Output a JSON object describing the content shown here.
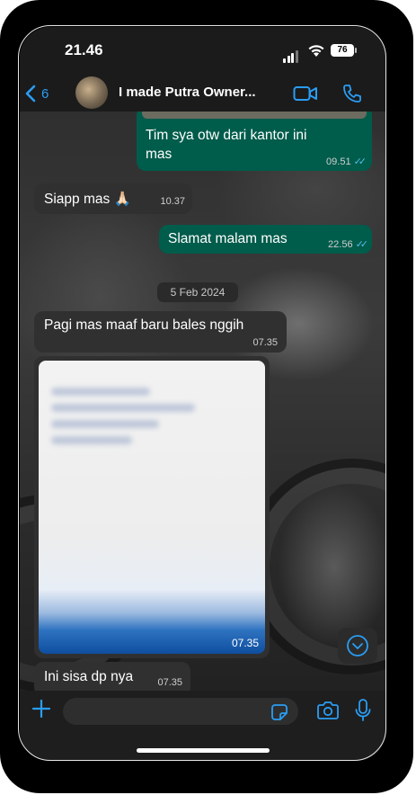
{
  "status_bar": {
    "time": "21.46",
    "battery": "76"
  },
  "header": {
    "back_count": "6",
    "contact_name": "I made Putra Owner..."
  },
  "messages": [
    {
      "text": "Tim sya otw dari kantor ini mas",
      "time": "09.51"
    },
    {
      "text": "Siapp mas 🙏🏻",
      "time": "10.37"
    },
    {
      "text": "Slamat malam mas",
      "time": "22.56"
    },
    {
      "text": "Pagi mas maaf baru bales nggih",
      "time": "07.35"
    },
    {
      "text": "Ini sisa dp nya",
      "time": "07.35"
    }
  ],
  "date_divider": "5 Feb 2024",
  "media": {
    "time": "07.35"
  },
  "composer": {
    "placeholder": ""
  },
  "colors": {
    "accent": "#2a9df4",
    "outgoing_bubble": "#005c4b",
    "incoming_bubble": "#303030",
    "read_ticks": "#53bdeb"
  },
  "icons": [
    "back-chevron-icon",
    "video-call-icon",
    "phone-icon",
    "chevron-down-icon",
    "plus-icon",
    "sticker-icon",
    "camera-icon",
    "microphone-icon",
    "double-check-icon"
  ]
}
